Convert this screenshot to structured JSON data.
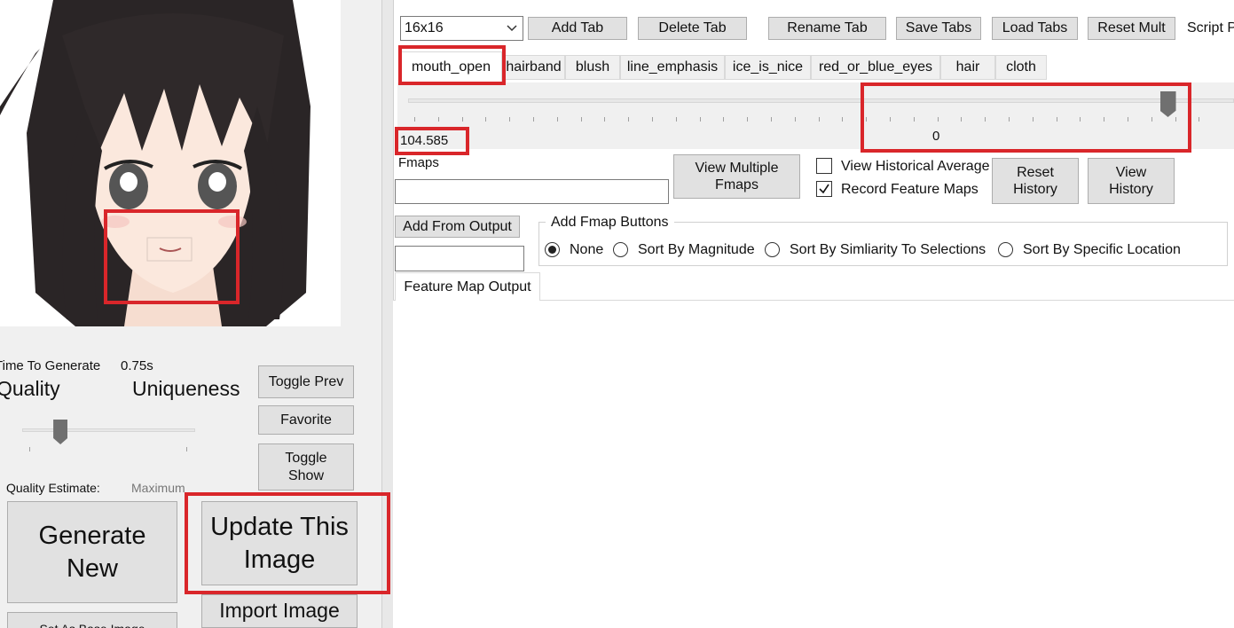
{
  "left_panel": {
    "time_label": "Time To Generate",
    "time_value": "0.75s",
    "quality_label": "Quality",
    "uniqueness_label": "Uniqueness",
    "quality_estimate_label": "Quality Estimate:",
    "quality_estimate_value": "Maximum",
    "quality_slider_fraction": 0.18,
    "buttons": {
      "toggle_prev": "Toggle Prev",
      "favorite": "Favorite",
      "toggle_show": "Toggle\nShow",
      "generate_new": "Generate\nNew",
      "update_image": "Update This\nImage",
      "import_image": "Import Image",
      "set_as_base": "Set As Base Image"
    }
  },
  "toolbar": {
    "size_select": "16x16",
    "add_tab": "Add Tab",
    "delete_tab": "Delete Tab",
    "rename_tab": "Rename Tab",
    "save_tabs": "Save Tabs",
    "load_tabs": "Load Tabs",
    "reset_mult": "Reset Mult",
    "script_label": "Script P"
  },
  "tabs": [
    "mouth_open",
    "hairband",
    "blush",
    "line_emphasis",
    "ice_is_nice",
    "red_or_blue_eyes",
    "hair",
    "cloth"
  ],
  "active_tab": "mouth_open",
  "slider": {
    "value_readout": "104.585",
    "center_label": "0",
    "fraction": 0.92
  },
  "fmaps": {
    "label": "Fmaps",
    "input_value": "",
    "view_multiple": "View Multiple\nFmaps",
    "view_historical_average": "View Historical Average",
    "view_historical_checked": false,
    "record_feature_maps": "Record Feature Maps",
    "record_checked": true,
    "reset_history": "Reset\nHistory",
    "view_history": "View\nHistory",
    "add_from_output": "Add From Output",
    "output_input_value": ""
  },
  "fmap_buttons_group": {
    "title": "Add Fmap Buttons",
    "options": [
      "None",
      "Sort By Magnitude",
      "Sort By Simliarity To Selections",
      "Sort By Specific Location"
    ],
    "selected": "None"
  },
  "output_tab": "Feature Map Output",
  "colors": {
    "highlight": "#d9262a",
    "panel_bg": "#f0f0f0",
    "button_bg": "#e1e1e1"
  }
}
